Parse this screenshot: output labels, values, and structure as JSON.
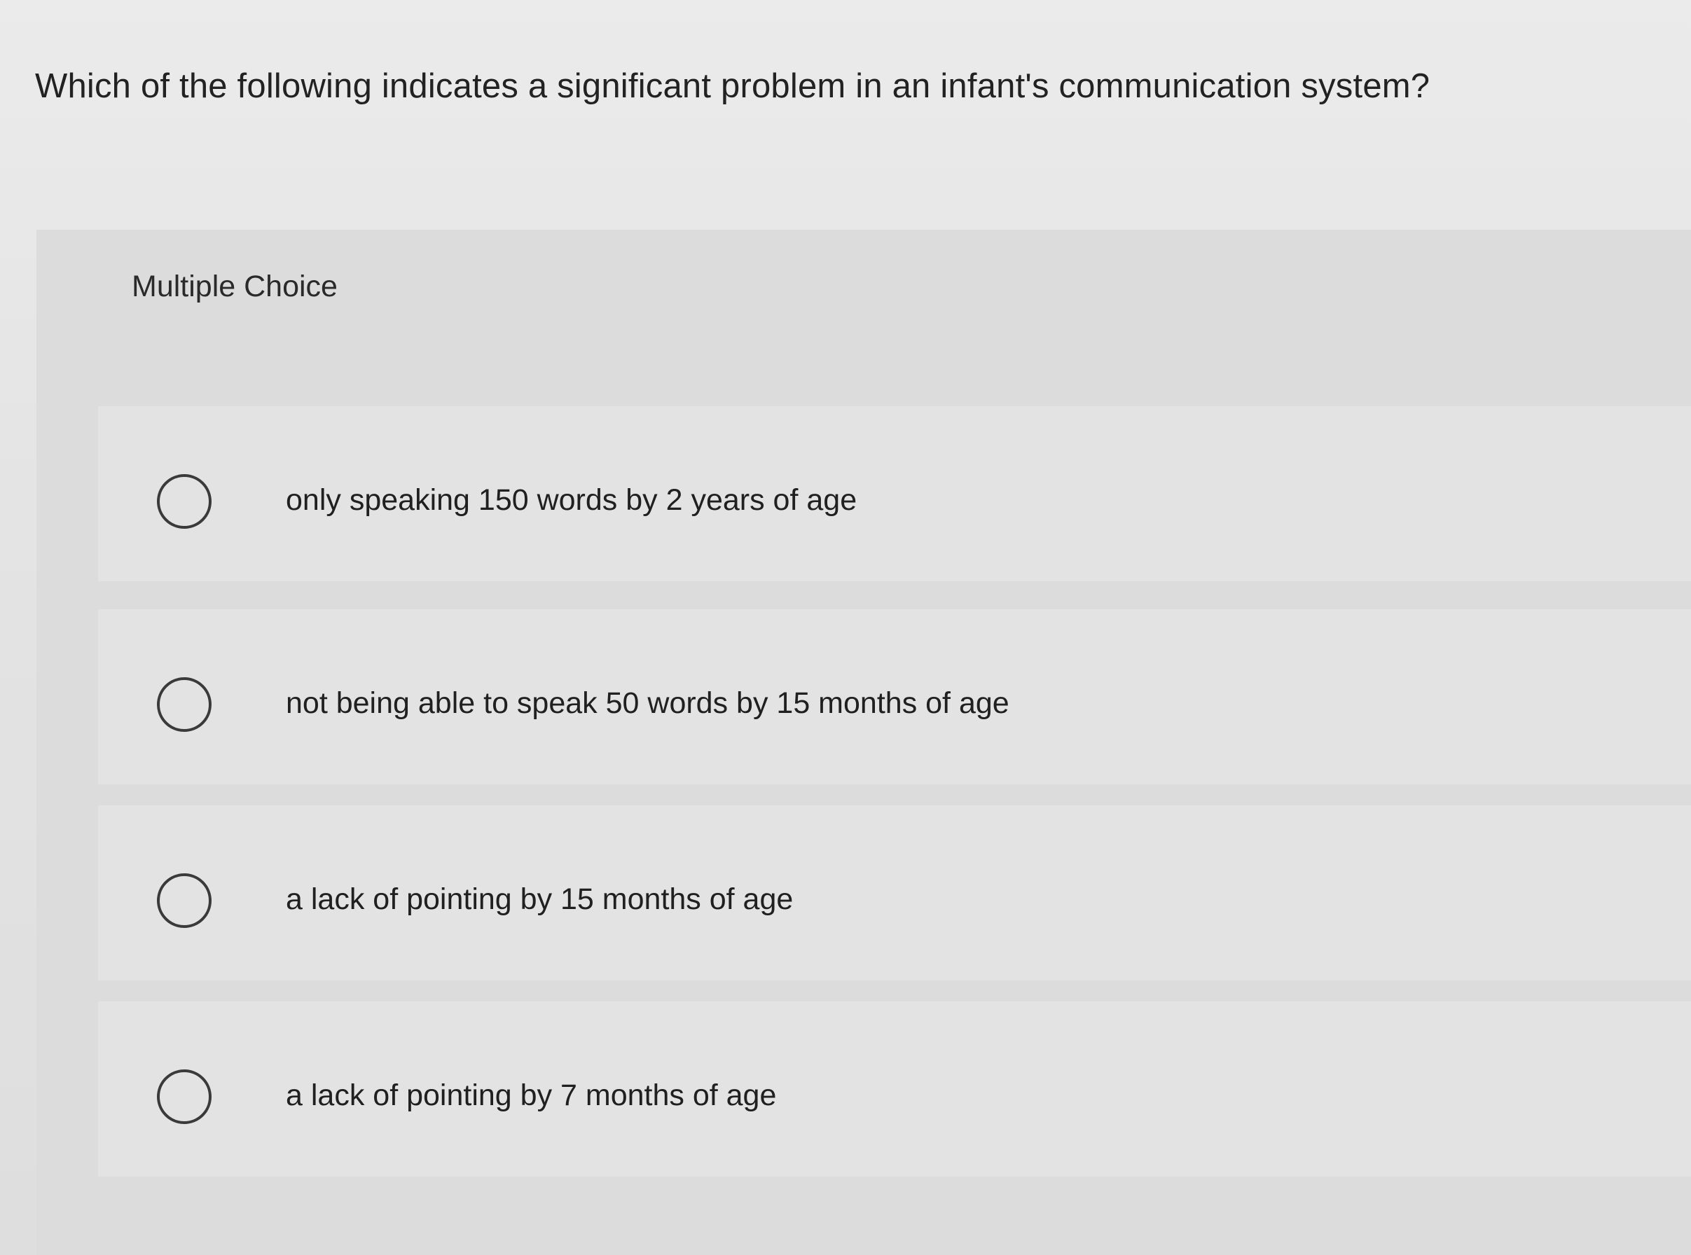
{
  "question": {
    "text": "Which of the following indicates a significant problem in an infant's communication system?"
  },
  "question_type": "Multiple Choice",
  "options": [
    {
      "label": "only speaking 150 words by 2 years of age",
      "selected": false
    },
    {
      "label": "not being able to speak 50 words by 15 months of age",
      "selected": false
    },
    {
      "label": "a lack of pointing by 15 months of age",
      "selected": false
    },
    {
      "label": "a lack of pointing by 7 months of age",
      "selected": false
    }
  ]
}
